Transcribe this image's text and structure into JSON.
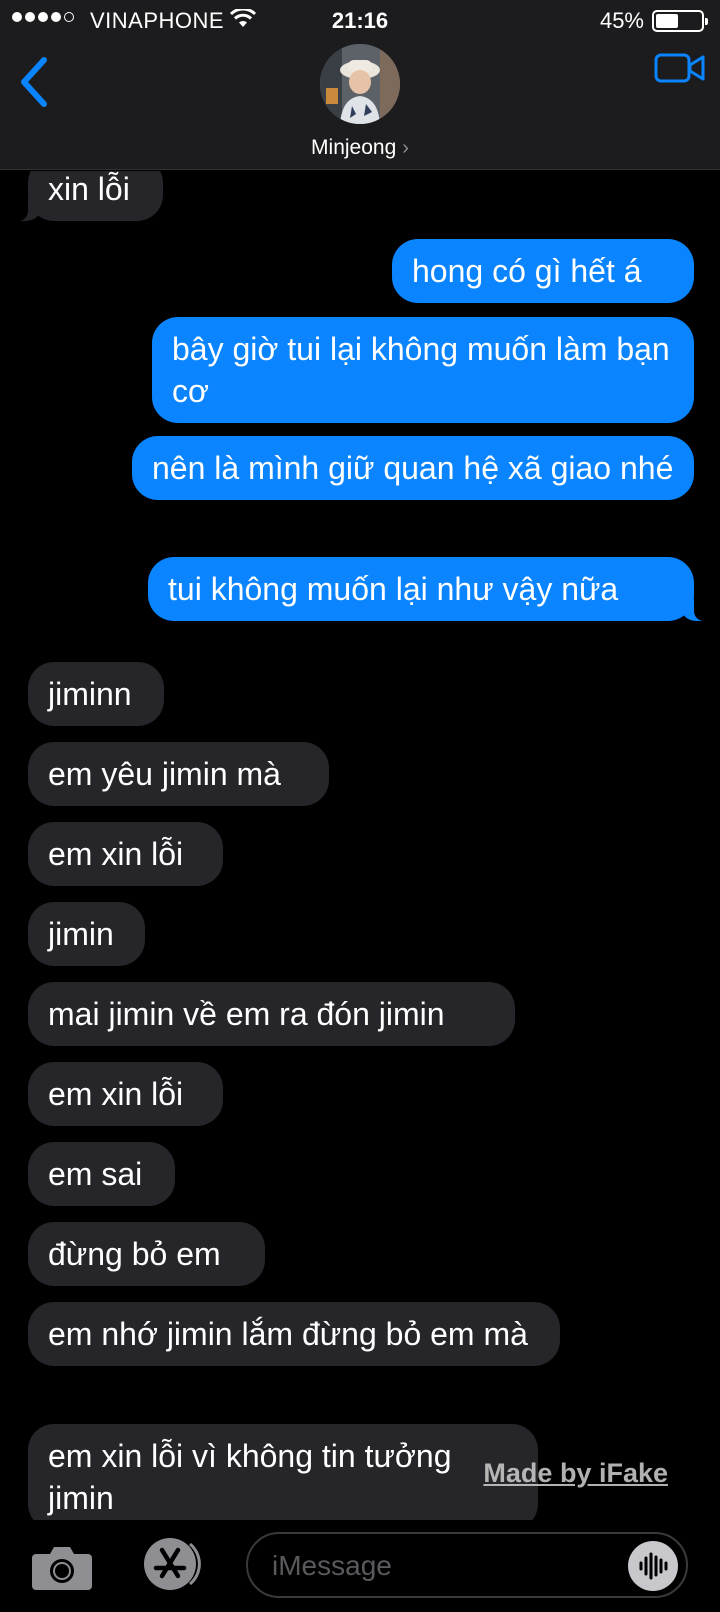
{
  "status_bar": {
    "carrier": "VINAPHONE",
    "time": "21:16",
    "battery_percent": "45%",
    "battery_level": 0.45
  },
  "header": {
    "contact_name": "Minjeong",
    "chevron": "›"
  },
  "messages": [
    {
      "from": "them",
      "text": "xin lỗi"
    },
    {
      "from": "me",
      "text": "hong có gì hết á"
    },
    {
      "from": "me",
      "text": "bây giờ tui lại không muốn làm bạn cơ"
    },
    {
      "from": "me",
      "text": "nên là mình giữ quan hệ xã giao nhé"
    },
    {
      "from": "me",
      "text": "tui không muốn lại như vậy nữa"
    },
    {
      "from": "them",
      "text": "jiminn"
    },
    {
      "from": "them",
      "text": "em yêu jimin mà"
    },
    {
      "from": "them",
      "text": "em xin lỗi"
    },
    {
      "from": "them",
      "text": "jimin"
    },
    {
      "from": "them",
      "text": "mai jimin về em ra đón jimin"
    },
    {
      "from": "them",
      "text": "em xin lỗi"
    },
    {
      "from": "them",
      "text": "em sai"
    },
    {
      "from": "them",
      "text": "đừng bỏ em"
    },
    {
      "from": "them",
      "text": "em nhớ jimin lắm đừng bỏ em mà"
    },
    {
      "from": "them",
      "text": "em xin lỗi vì không tin tưởng jimin"
    }
  ],
  "watermark": "Made by iFake",
  "input": {
    "placeholder": "iMessage",
    "value": ""
  },
  "icons": {
    "back": "chevron-left-icon",
    "video": "video-camera-icon",
    "camera": "camera-icon",
    "appstore": "app-store-icon",
    "audio": "audio-waveform-icon"
  },
  "colors": {
    "sent_bubble": "#0a84ff",
    "received_bubble": "#26252a",
    "accent": "#0a84ff"
  }
}
